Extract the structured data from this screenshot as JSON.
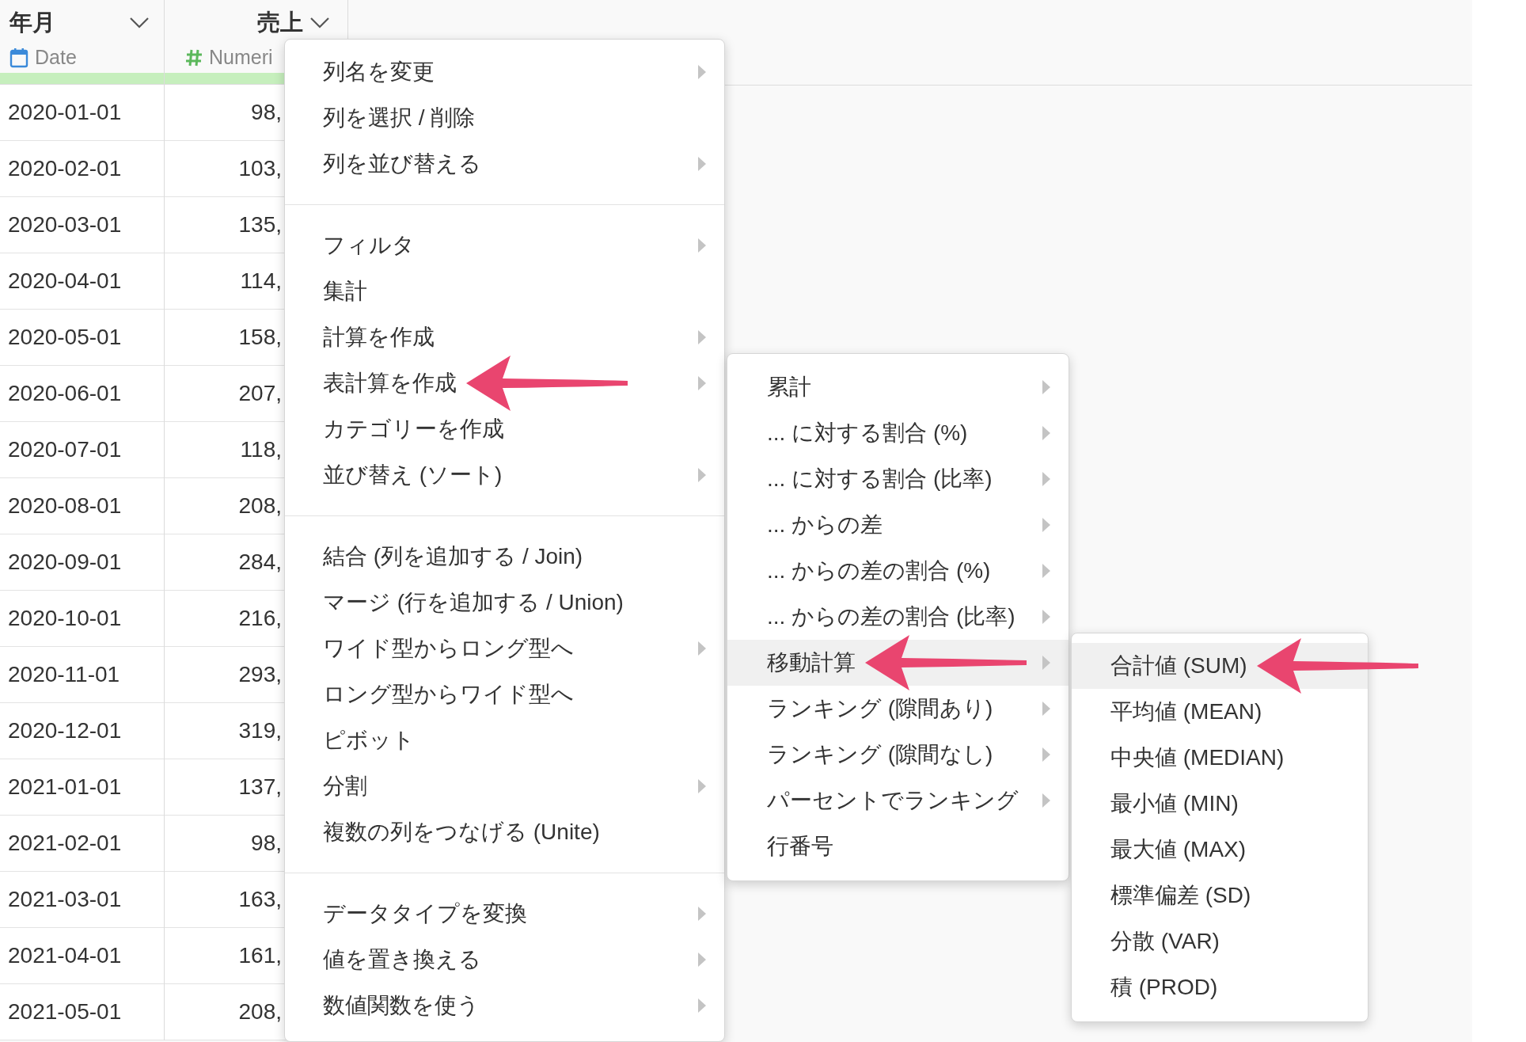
{
  "table": {
    "columns": [
      {
        "title": "年月",
        "type_label": "Date",
        "kind": "date"
      },
      {
        "title": "売上",
        "type_label": "Numeri",
        "kind": "number"
      }
    ],
    "rows": [
      [
        "2020-01-01",
        "98,"
      ],
      [
        "2020-02-01",
        "103,"
      ],
      [
        "2020-03-01",
        "135,"
      ],
      [
        "2020-04-01",
        "114,"
      ],
      [
        "2020-05-01",
        "158,"
      ],
      [
        "2020-06-01",
        "207,"
      ],
      [
        "2020-07-01",
        "118,"
      ],
      [
        "2020-08-01",
        "208,"
      ],
      [
        "2020-09-01",
        "284,"
      ],
      [
        "2020-10-01",
        "216,"
      ],
      [
        "2020-11-01",
        "293,"
      ],
      [
        "2020-12-01",
        "319,"
      ],
      [
        "2021-01-01",
        "137,"
      ],
      [
        "2021-02-01",
        "98,"
      ],
      [
        "2021-03-01",
        "163,"
      ],
      [
        "2021-04-01",
        "161,"
      ],
      [
        "2021-05-01",
        "208,"
      ]
    ]
  },
  "context_menu": {
    "sections": [
      [
        {
          "label": "列名を変更",
          "submenu": true,
          "selected": false,
          "pointed": false
        },
        {
          "label": "列を選択 / 削除",
          "submenu": false,
          "selected": false,
          "pointed": false
        },
        {
          "label": "列を並び替える",
          "submenu": true,
          "selected": false,
          "pointed": false
        }
      ],
      [
        {
          "label": "フィルタ",
          "submenu": true,
          "selected": false,
          "pointed": false
        },
        {
          "label": "集計",
          "submenu": false,
          "selected": false,
          "pointed": false
        },
        {
          "label": "計算を作成",
          "submenu": true,
          "selected": false,
          "pointed": false
        },
        {
          "label": "表計算を作成",
          "submenu": true,
          "selected": false,
          "pointed": true
        },
        {
          "label": "カテゴリーを作成",
          "submenu": false,
          "selected": false,
          "pointed": false
        },
        {
          "label": "並び替え (ソート)",
          "submenu": true,
          "selected": false,
          "pointed": false
        }
      ],
      [
        {
          "label": "結合 (列を追加する / Join)",
          "submenu": false,
          "selected": false,
          "pointed": false
        },
        {
          "label": "マージ (行を追加する / Union)",
          "submenu": false,
          "selected": false,
          "pointed": false
        },
        {
          "label": "ワイド型からロング型へ",
          "submenu": true,
          "selected": false,
          "pointed": false
        },
        {
          "label": "ロング型からワイド型へ",
          "submenu": false,
          "selected": false,
          "pointed": false
        },
        {
          "label": "ピボット",
          "submenu": false,
          "selected": false,
          "pointed": false
        },
        {
          "label": "分割",
          "submenu": true,
          "selected": false,
          "pointed": false
        },
        {
          "label": "複数の列をつなげる (Unite)",
          "submenu": false,
          "selected": false,
          "pointed": false
        }
      ],
      [
        {
          "label": "データタイプを変換",
          "submenu": true,
          "selected": false,
          "pointed": false
        },
        {
          "label": "値を置き換える",
          "submenu": true,
          "selected": false,
          "pointed": false
        },
        {
          "label": "数値関数を使う",
          "submenu": true,
          "selected": false,
          "pointed": false
        }
      ]
    ]
  },
  "submenu": {
    "items": [
      {
        "label": "累計",
        "submenu": true,
        "selected": false,
        "pointed": false
      },
      {
        "label": "... に対する割合 (%)",
        "submenu": true,
        "selected": false,
        "pointed": false
      },
      {
        "label": "... に対する割合 (比率)",
        "submenu": true,
        "selected": false,
        "pointed": false
      },
      {
        "label": "... からの差",
        "submenu": true,
        "selected": false,
        "pointed": false
      },
      {
        "label": "... からの差の割合 (%)",
        "submenu": true,
        "selected": false,
        "pointed": false
      },
      {
        "label": "... からの差の割合 (比率)",
        "submenu": true,
        "selected": false,
        "pointed": false
      },
      {
        "label": "移動計算",
        "submenu": true,
        "selected": true,
        "pointed": true
      },
      {
        "label": "ランキング (隙間あり)",
        "submenu": true,
        "selected": false,
        "pointed": false
      },
      {
        "label": "ランキング (隙間なし)",
        "submenu": true,
        "selected": false,
        "pointed": false
      },
      {
        "label": "パーセントでランキング",
        "submenu": true,
        "selected": false,
        "pointed": false
      },
      {
        "label": "行番号",
        "submenu": false,
        "selected": false,
        "pointed": false
      }
    ]
  },
  "submenu_2": {
    "items": [
      {
        "label": "合計値 (SUM)",
        "submenu": false,
        "selected": true,
        "pointed": true
      },
      {
        "label": "平均値 (MEAN)",
        "submenu": false,
        "selected": false,
        "pointed": false
      },
      {
        "label": "中央値 (MEDIAN)",
        "submenu": false,
        "selected": false,
        "pointed": false
      },
      {
        "label": "最小値 (MIN)",
        "submenu": false,
        "selected": false,
        "pointed": false
      },
      {
        "label": "最大値 (MAX)",
        "submenu": false,
        "selected": false,
        "pointed": false
      },
      {
        "label": "標準偏差 (SD)",
        "submenu": false,
        "selected": false,
        "pointed": false
      },
      {
        "label": "分散 (VAR)",
        "submenu": false,
        "selected": false,
        "pointed": false
      },
      {
        "label": "積 (PROD)",
        "submenu": false,
        "selected": false,
        "pointed": false
      }
    ]
  }
}
